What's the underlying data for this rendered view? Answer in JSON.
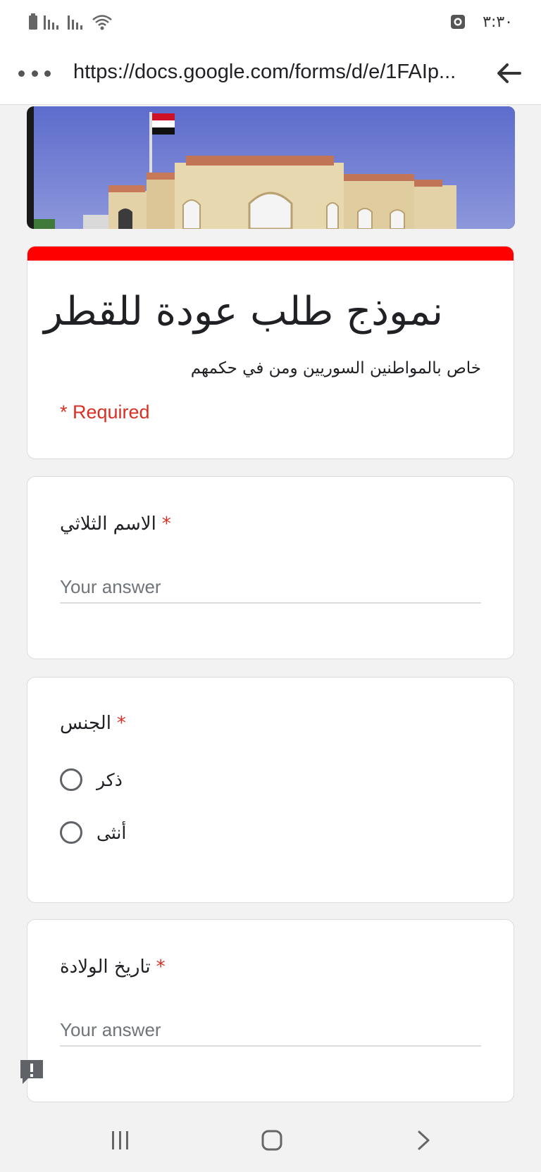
{
  "status_bar": {
    "time": "٣:٣٠"
  },
  "browser": {
    "url": "https://docs.google.com/forms/d/e/1FAIp..."
  },
  "form": {
    "title": "نموذج طلب عودة للقطر",
    "description": "خاص بالمواطنين السوريين ومن في حكمهم",
    "required_note": "* Required",
    "accent_color": "#ff0000",
    "questions": [
      {
        "title": "الاسم الثلاثي",
        "required_mark": "*",
        "placeholder": "Your answer"
      },
      {
        "title": "الجنس",
        "required_mark": "*",
        "options": [
          "ذكر",
          "أنثى"
        ]
      },
      {
        "title": "تاريخ الولادة",
        "required_mark": "*",
        "placeholder": "Your answer"
      }
    ]
  },
  "icons": {
    "status": [
      "battery-icon",
      "signal-icon",
      "signal-icon",
      "wifi-icon",
      "alarm-icon"
    ],
    "browser": [
      "more-icon",
      "back-arrow-icon"
    ],
    "nav": [
      "recent-apps-icon",
      "home-icon",
      "back-icon"
    ],
    "report": "report-issue-icon"
  }
}
